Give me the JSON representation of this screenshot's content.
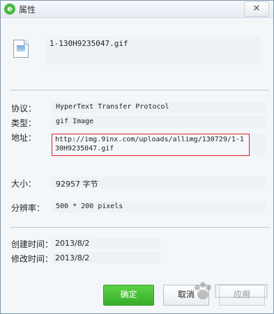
{
  "window": {
    "title": "属性",
    "close_glyph": "✕"
  },
  "file": {
    "name": "1-130H9235047.gif",
    "icon": "image-file-icon"
  },
  "properties": {
    "protocol_label": "协议：",
    "protocol_value": "HyperText Transfer Protocol",
    "type_label": "类型：",
    "type_value": "gif Image",
    "address_label": "地址：",
    "address_value": "http://img.9inx.com/uploads/allimg/130729/1-130H9235047.gif",
    "size_label": "大小：",
    "size_value": "92957 字节",
    "resolution_label": "分辨率：",
    "resolution_value": "500 * 200 pixels",
    "created_label": "创建时间：",
    "created_value": "2013/8/2",
    "modified_label": "修改时间：",
    "modified_value": "2013/8/2"
  },
  "buttons": {
    "ok": "确定",
    "cancel": "取消",
    "apply": "应用"
  },
  "colors": {
    "ok_button": "#45bf35",
    "url_highlight_border": "#e02020",
    "app_icon": "#4bb842"
  }
}
